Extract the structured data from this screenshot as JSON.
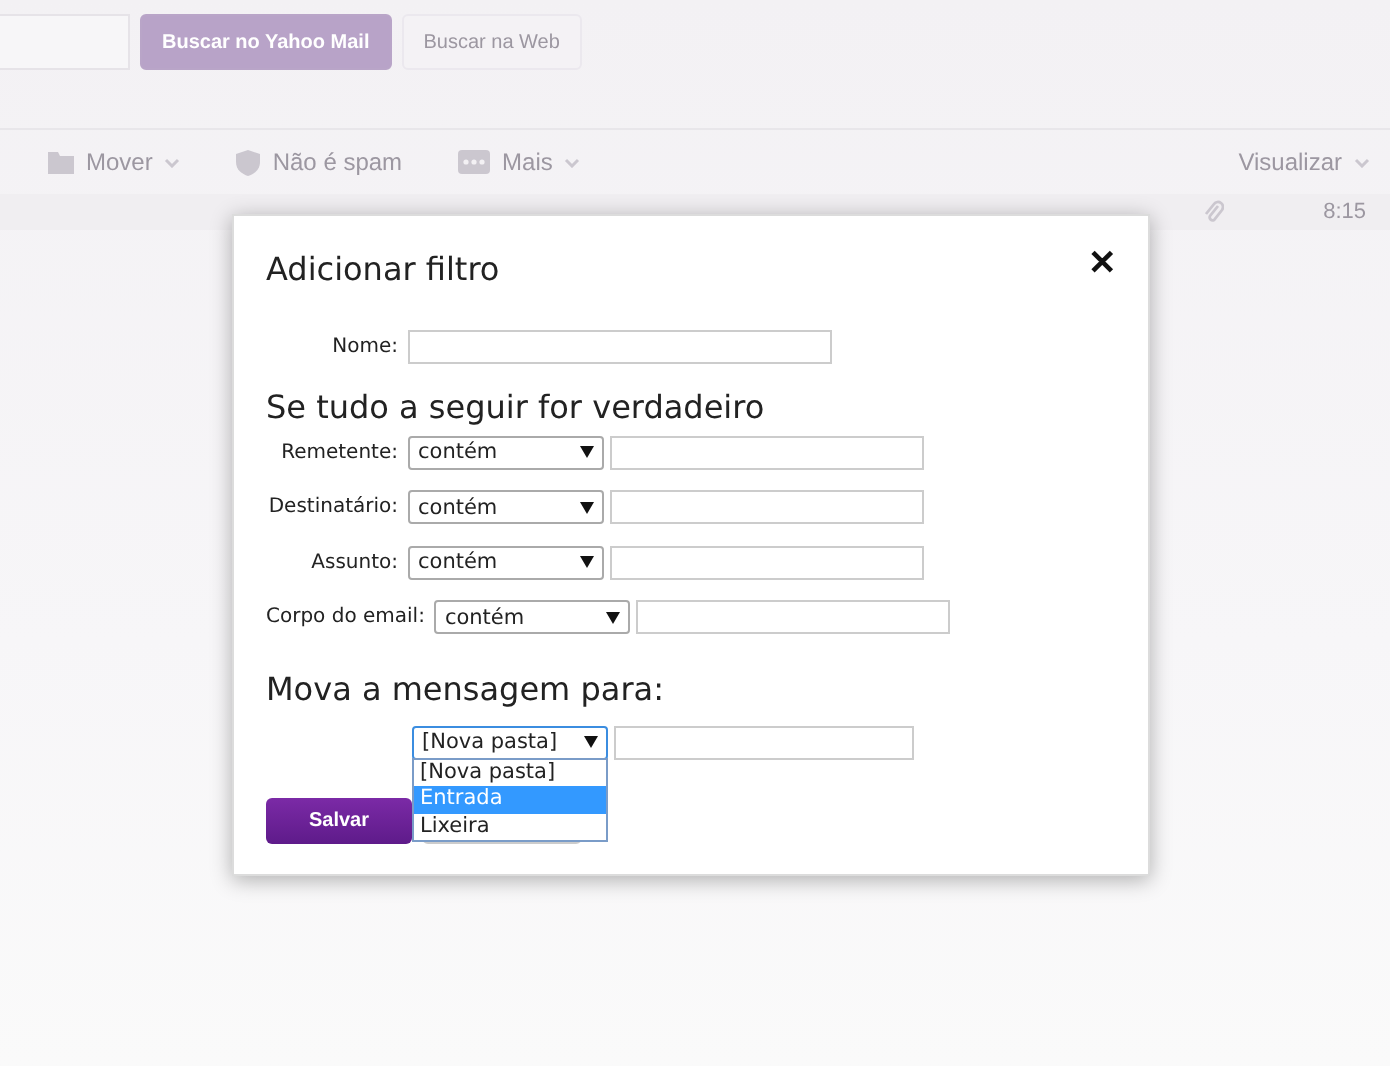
{
  "search_buttons": [
    {
      "label": "Buscar no Yahoo Mail",
      "kind": "primary"
    },
    {
      "label": "Buscar na Web",
      "kind": "secondary"
    }
  ],
  "toolbar": [
    {
      "label": "Mover",
      "menu": true
    },
    {
      "label": "Não é spam",
      "menu": false
    },
    {
      "label": "Mais",
      "menu": true
    }
  ],
  "view_menu": "Visualizar",
  "message_row": {
    "attachment": true,
    "time": "8:15"
  },
  "dialog": {
    "title": "Adicionar filtro",
    "close": "✕",
    "name_label": "Nome:",
    "conditions_heading": "Se tudo a seguir for verdadeiro",
    "conditions": [
      {
        "label": "Remetente:",
        "operator": "contém"
      },
      {
        "label": "Destinatário:",
        "operator": "contém"
      },
      {
        "label": "Assunto:",
        "operator": "contém"
      },
      {
        "label": "Corpo do email:",
        "operator": "contém"
      }
    ],
    "move_heading": "Mova a mensagem para:",
    "folder_select": {
      "value": "[Nova pasta]",
      "expanded": true,
      "options": [
        {
          "label": "[Nova pasta]",
          "highlighted": false
        },
        {
          "label": "Entrada",
          "highlighted": true
        },
        {
          "label": "Lixeira",
          "highlighted": false
        }
      ]
    },
    "save": "Salvar"
  }
}
